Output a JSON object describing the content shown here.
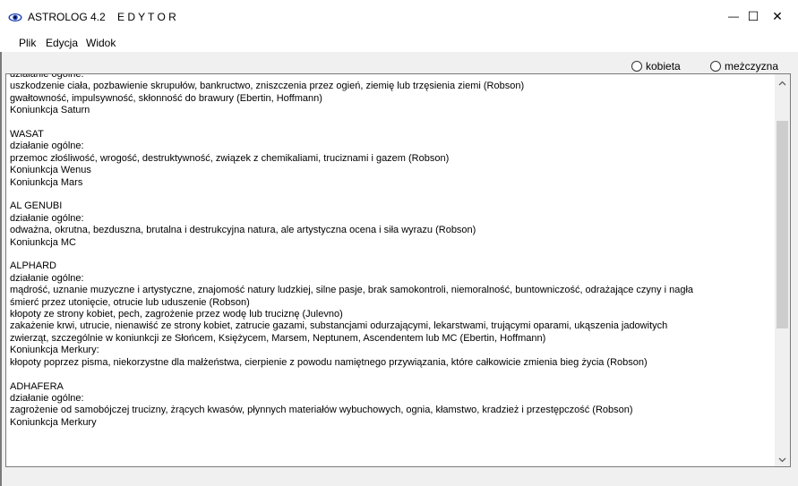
{
  "window": {
    "title": "ASTROLOG 4.2    E D Y T O R",
    "minimize": "—",
    "maximize": "☐",
    "close": "✕"
  },
  "menu": {
    "items": [
      "Plik",
      "Edycja",
      "Widok"
    ]
  },
  "gender": {
    "options": [
      "kobieta",
      "meżczyzna"
    ]
  },
  "editor": {
    "lines": [
      "działanie ogólne:",
      "uszkodzenie ciała, pozbawienie skrupułów, bankructwo, zniszczenia przez ogień, ziemię lub trzęsienia ziemi (Robson)",
      "gwałtowność, impulsywność, skłonność do brawury (Ebertin, Hoffmann)",
      "Koniunkcja Saturn",
      "",
      "WASAT",
      "działanie ogólne:",
      "przemoc złośliwość, wrogość, destruktywność, związek z chemikaliami, truciznami i gazem (Robson)",
      "Koniunkcja Wenus",
      "Koniunkcja Mars",
      "",
      "AL GENUBI",
      "działanie ogólne:",
      "odważna, okrutna, bezduszna, brutalna i destrukcyjna natura, ale artystyczna ocena i siła wyrazu (Robson)",
      "Koniunkcja MC",
      "",
      "ALPHARD",
      "działanie ogólne:",
      "mądrość, uznanie muzyczne i artystyczne, znajomość natury ludzkiej, silne pasje, brak samokontroli, niemoralność, buntowniczość, odrażające czyny i nagła",
      "śmierć przez utonięcie, otrucie lub uduszenie (Robson)",
      "kłopoty ze strony kobiet, pech, zagrożenie przez wodę lub truciznę (Julevno)",
      "zakażenie krwi, utrucie, nienawiść ze strony kobiet, zatrucie gazami, substancjami odurzającymi, lekarstwami, trującymi oparami, ukąszenia jadowitych",
      "zwierząt, szczególnie w koniunkcji ze Słońcem, Księżycem, Marsem, Neptunem, Ascendentem lub MC (Ebertin, Hoffmann)",
      "Koniunkcja Merkury:",
      "kłopoty poprzez pisma, niekorzystne dla małżeństwa, cierpienie z powodu namiętnego przywiązania, które całkowicie zmienia bieg życia (Robson)",
      "",
      "ADHAFERA",
      "działanie ogólne:",
      "zagrożenie od samobójczej trucizny, żrących kwasów, płynnych materiałów wybuchowych, ognia, kłamstwo, kradzież i przestępczość (Robson)",
      "Koniunkcja Merkury"
    ]
  }
}
